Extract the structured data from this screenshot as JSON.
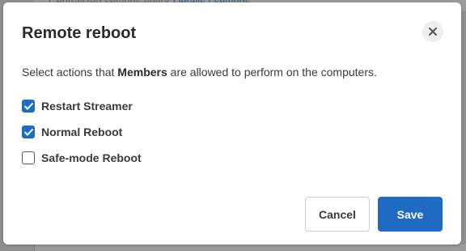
{
  "background": {
    "text": "Centralized settings editor",
    "link": "Details / settings"
  },
  "dialog": {
    "title": "Remote reboot",
    "close_icon": "close-icon",
    "description_before": "Select actions that ",
    "description_bold": "Members",
    "description_after": " are allowed to perform on the computers.",
    "options": [
      {
        "label": "Restart Streamer",
        "checked": true
      },
      {
        "label": "Normal Reboot",
        "checked": true
      },
      {
        "label": "Safe-mode Reboot",
        "checked": false
      }
    ],
    "buttons": {
      "cancel": "Cancel",
      "save": "Save"
    }
  },
  "colors": {
    "accent": "#1f6bc4",
    "overlay": "#8e8e8e"
  }
}
